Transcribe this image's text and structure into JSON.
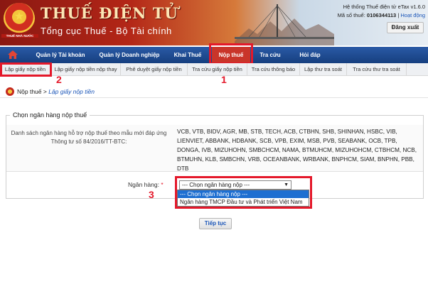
{
  "header": {
    "emblem_text": "THUẾ NHÀ NƯỚC",
    "brand_title": "THUẾ ĐIỆN TỬ",
    "brand_subtitle": "Tổng cục Thuế - Bộ Tài chính",
    "system_info": "Hệ thống Thuế điện tử eTax v1.6.0",
    "tax_code_label": "Mã số thuế:",
    "tax_code": "0106344113",
    "separator": "|",
    "help_link": "Hoạt động",
    "logout_label": "Đăng xuất"
  },
  "nav": {
    "items": [
      {
        "label": "Quản lý Tài khoản"
      },
      {
        "label": "Quản lý Doanh nghiệp"
      },
      {
        "label": "Khai Thuế"
      },
      {
        "label": "Nộp thuế"
      },
      {
        "label": "Tra cứu"
      },
      {
        "label": "Hỏi đáp"
      }
    ]
  },
  "subnav": {
    "items": [
      {
        "label": "Lập giấy nộp tiền"
      },
      {
        "label": "Lập giấy nộp tiền nộp thay"
      },
      {
        "label": "Phê duyệt giấy nộp tiền"
      },
      {
        "label": "Tra cứu giấy nộp tiền"
      },
      {
        "label": "Tra cứu thông báo"
      },
      {
        "label": "Lập thư tra soát"
      },
      {
        "label": "Tra cứu thư tra soát"
      }
    ]
  },
  "breadcrumb": {
    "parent": "Nộp thuế",
    "sep": " > ",
    "current": "Lập giấy nộp tiền"
  },
  "form": {
    "legend": "Chọn ngân hàng nộp thuế",
    "banks_label": "Danh sách ngân hàng hỗ trợ nộp thuế theo mẫu mới đáp ứng Thông tư số 84/2016/TT-BTC:",
    "banks_list": "VCB, VTB, BIDV, AGR, MB, STB, TECH, ACB, CTBHN, SHB, SHINHAN, HSBC, VIB, LIENVIET, ABBANK, HDBANK, SCB, VPB, EXIM, MSB, PVB, SEABANK, OCB, TPB, DONGA, IVB, MIZUHOHN, SMBCHCM, NAMA, BTMUHCM, MIZUHOHCM, CTBHCM, NCB, BTMUHN, KLB, SMBCHN, VRB, OCEANBANK, WRBANK, BNPHCM, SIAM, BNPHN, PBB, DTB",
    "bank_field_label": "Ngân hàng:",
    "required_mark": "*",
    "select_value": "--- Chọn ngân hàng nộp ---",
    "options": [
      {
        "label": "--- Chọn ngân hàng nộp ---"
      },
      {
        "label": "Ngân hàng TMCP Đầu tư và Phát triển Việt Nam"
      }
    ],
    "continue_label": "Tiếp tục"
  },
  "annotations": {
    "step1": "1",
    "step2": "2",
    "step3": "3",
    "color": "#e4182a"
  }
}
